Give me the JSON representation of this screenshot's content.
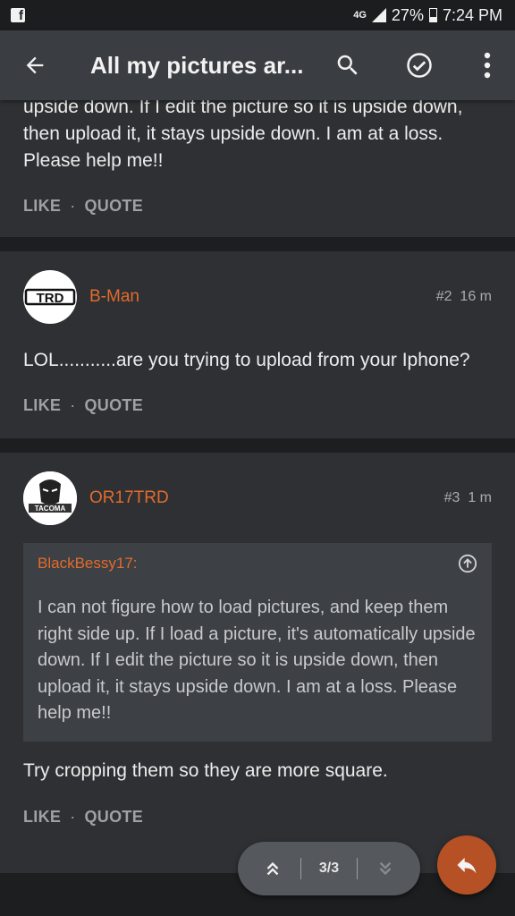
{
  "status_bar": {
    "network": "4G",
    "battery": "27%",
    "time": "7:24 PM"
  },
  "app_bar": {
    "title": "All my pictures ar..."
  },
  "posts": [
    {
      "text": "upside down. If I edit the picture so it is upside down, then upload it, it stays upside down. I am at a loss. Please help me!!",
      "like": "LIKE",
      "quote": "QUOTE"
    },
    {
      "username": "B-Man",
      "avatar_text": "TRD",
      "post_number": "#2",
      "time": "16 m",
      "text": "LOL...........are you trying to upload from your Iphone?",
      "like": "LIKE",
      "quote": "QUOTE"
    },
    {
      "username": "OR17TRD",
      "avatar_text": "TACOMA",
      "post_number": "#3",
      "time": "1 m",
      "quote_author": "BlackBessy17:",
      "quote_text": "I can not figure how to load pictures, and keep them right side up. If I load a picture, it's automatically upside down. If I edit the picture so it is upside down, then upload it, it stays upside down. I am at a loss. Please help me!!",
      "text": "Try cropping them so they are more square.",
      "like": "LIKE",
      "quote": "QUOTE"
    }
  ],
  "pager": {
    "label": "3/3"
  },
  "colors": {
    "accent": "#e36b2c",
    "fab": "#b65125",
    "card": "#2e3033"
  }
}
